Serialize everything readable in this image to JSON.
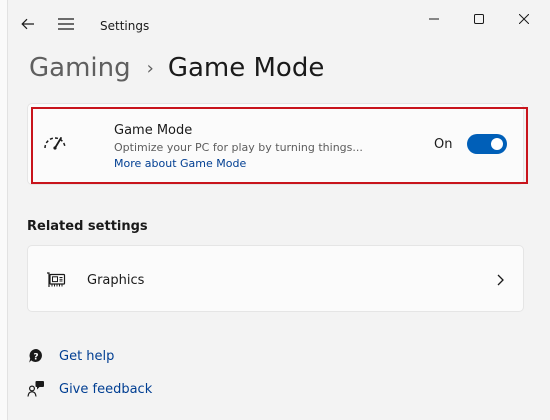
{
  "window": {
    "title": "Settings"
  },
  "breadcrumb": {
    "parent": "Gaming",
    "separator": "›",
    "current": "Game Mode"
  },
  "game_mode_card": {
    "icon": "speedometer-icon",
    "title": "Game Mode",
    "description": "Optimize your PC for play by turning things...",
    "link": "More about Game Mode",
    "toggle_state": "On",
    "toggle_on": true
  },
  "related_settings": {
    "heading": "Related settings",
    "items": [
      {
        "icon": "graphics-card-icon",
        "label": "Graphics"
      }
    ]
  },
  "help_links": [
    {
      "icon": "help-icon",
      "label": "Get help"
    },
    {
      "icon": "feedback-icon",
      "label": "Give feedback"
    }
  ],
  "colors": {
    "accent": "#005fb8",
    "link": "#003e92",
    "highlight_border": "#c8141c",
    "background": "#f3f3f3"
  }
}
